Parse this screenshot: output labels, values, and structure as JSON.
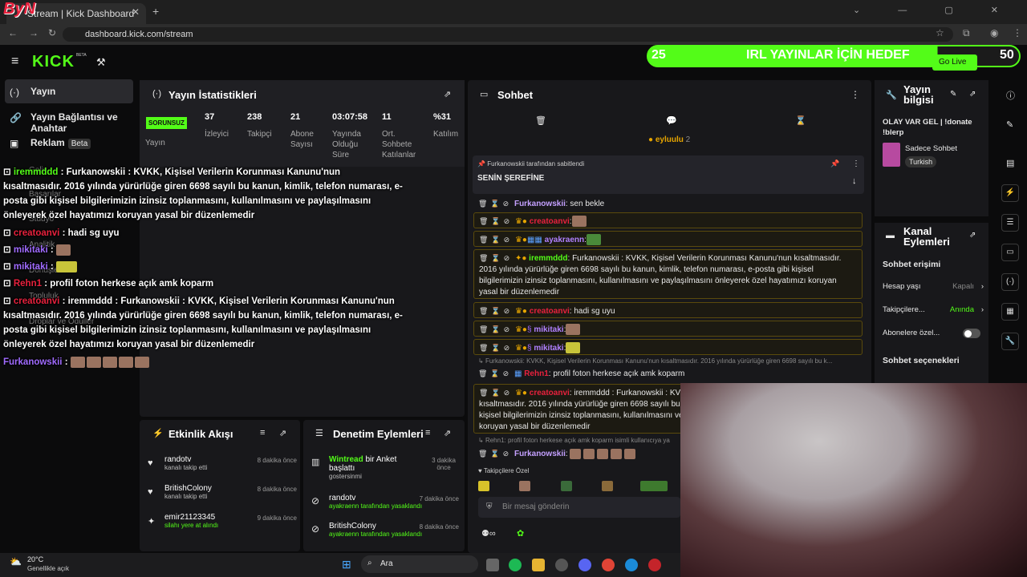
{
  "browser": {
    "tab_title": "Stream | Kick Dashboard",
    "url": "dashboard.kick.com/stream",
    "corner_logo": "ByN"
  },
  "topbar": {
    "logo": "KICK",
    "beta": "BETA",
    "goal_left": "25",
    "goal_text": "IRL YAYINLAR İÇİN HEDEF",
    "goal_right": "50",
    "goal_progress": 0.78,
    "go_live": "Go Live"
  },
  "sidebar": {
    "items": [
      {
        "label": "Yayın",
        "icon": "(·)"
      },
      {
        "label": "Yayın Bağlantısı ve Anahtar",
        "icon": "🔗"
      },
      {
        "label": "Reklam",
        "icon": "▣",
        "badge": "Beta"
      }
    ],
    "hidden_items": [
      "Gelir",
      "Başarılar",
      "Stüdyo",
      "Analitik",
      "Dönüşlere",
      "Topluluk",
      "Droplar ve Ödüller"
    ]
  },
  "stats": {
    "title": "Yayın İstatistikleri",
    "status_badge": "SORUNSUZ",
    "columns": [
      {
        "value": "",
        "label": "Yayın"
      },
      {
        "value": "37",
        "label": "İzleyici"
      },
      {
        "value": "238",
        "label": "Takipçi"
      },
      {
        "value": "21",
        "label": "Abone Sayısı"
      },
      {
        "value": "03:07:58",
        "label": "Yayında Olduğu Süre"
      },
      {
        "value": "11",
        "label": "Ort. Sohbete Katılanlar"
      },
      {
        "value": "%31",
        "label": "Katılım"
      }
    ]
  },
  "overlay": {
    "lines": [
      {
        "name": "iremmddd",
        "cls": "g",
        "text": " : Furkanowskii : KVKK, Kişisel Verilerin Korunması Kanunu'nun"
      },
      {
        "name": "",
        "cls": "",
        "text": "kısaltmasıdır. 2016 yılında yürürlüğe giren 6698 sayılı bu kanun, kimlik, telefon numarası, e-"
      },
      {
        "name": "",
        "cls": "",
        "text": "posta gibi kişisel bilgilerimizin izinsiz toplanmasını, kullanılmasını ve paylaşılmasını"
      },
      {
        "name": "",
        "cls": "",
        "text": "önleyerek özel hayatımızı koruyan yasal bir düzenlemedir"
      },
      {
        "name": "creatoanvi",
        "cls": "r",
        "text": " : hadi sg uyu"
      },
      {
        "name": "mikitaki",
        "cls": "p",
        "text": " :"
      },
      {
        "name": "mikitaki",
        "cls": "p",
        "text": " :"
      },
      {
        "name": "Rehn1",
        "cls": "r",
        "text": " : profil foton herkese açık amk koparm"
      },
      {
        "name": "creatoanvi",
        "cls": "r",
        "text": " : iremmddd : Furkanowskii : KVKK, Kişisel Verilerin Korunması Kanunu'nun"
      },
      {
        "name": "",
        "cls": "",
        "text": "kısaltmasıdır. 2016 yılında yürürlüğe giren 6698 sayılı bu kanun, kimlik, telefon numarası, e-"
      },
      {
        "name": "",
        "cls": "",
        "text": "posta gibi kişisel bilgilerimizin izinsiz toplanmasını, kullanılmasını ve paylaşılmasını"
      },
      {
        "name": "",
        "cls": "",
        "text": "önleyerek özel hayatımızı koruyan yasal bir düzenlemedir"
      },
      {
        "name": "Furkanowskii",
        "cls": "v",
        "text": " :"
      }
    ]
  },
  "activity": {
    "title": "Etkinlik Akışı",
    "items": [
      {
        "name": "randotv",
        "sub": "kanalı takip etti",
        "time": "8 dakika önce"
      },
      {
        "name": "BritishColony",
        "sub": "kanalı takip etti",
        "time": "8 dakika önce"
      },
      {
        "name": "emir21123345",
        "sub": "silahı yere at alındı",
        "time": "9 dakika önce"
      }
    ]
  },
  "moderation": {
    "title": "Denetim Eylemleri",
    "items": [
      {
        "name": "Wintread",
        "action": " bir Anket başlattı",
        "sub": "gostersinmi",
        "time": "3 dakika önce"
      },
      {
        "name": "randotv",
        "action": "",
        "sub": "ayakraenn tarafından yasaklandı",
        "time": "7 dakika önce"
      },
      {
        "name": "BritishColony",
        "action": "",
        "sub": "ayakraenn tarafından yasaklandı",
        "time": "8 dakika önce"
      }
    ]
  },
  "chat": {
    "title": "Sohbet",
    "pinned_user": "eyluulu",
    "pinned_count": "2",
    "pinned_by": "Furkanowskii tarafından sabitlendi",
    "pinned_msg": "SENİN ŞEREFİNE",
    "messages": [
      {
        "name": "Furkanowskii",
        "cls": "v",
        "text": ": sen bekle"
      },
      {
        "name": "creatoanvi",
        "cls": "r",
        "text": ":"
      },
      {
        "name": "ayakraenn",
        "cls": "p",
        "text": ":"
      },
      {
        "name": "iremmddd",
        "cls": "g",
        "text": ": Furkanowskii : KVKK, Kişisel Verilerin Korunması Kanunu'nun kısaltmasıdır. 2016 yılında yürürlüğe giren 6698 sayılı bu kanun, kimlik, telefon numarası, e-posta gibi kişisel bilgilerimizin izinsiz toplanmasını, kullanılmasını ve paylaşılmasını önleyerek özel hayatımızı koruyan yasal bir düzenlemedir"
      },
      {
        "name": "creatoanvi",
        "cls": "r",
        "text": ": hadi sg uyu"
      },
      {
        "name": "mikitaki",
        "cls": "p",
        "text": ":"
      },
      {
        "name": "mikitaki",
        "cls": "p",
        "text": ":"
      },
      {
        "name": "Rehn1",
        "cls": "r",
        "text": ": profil foton herkese açık amk koparm"
      },
      {
        "name": "creatoanvi",
        "cls": "r",
        "text": ": iremmddd : Furkanowskii : KVKK, Kişisel Verilerin Korunması Kanunu'nun kısaltmasıdır. 2016 yılında yürürlüğe giren 6698 sayılı bu kanun, kimlik, telefon numarası, e-posta gibi kişisel bilgilerimizin izinsiz toplanmasını, kullanılmasını ve paylaşılmasını önleyerek özel hayatımızı koruyan yasal bir düzenlemedir"
      },
      {
        "name": "Furkanowskii",
        "cls": "v",
        "text": ":"
      }
    ],
    "reply_rehn": "Furkanowskii: KVKK, Kişisel Verilerin Korunması Kanunu'nun kısaltmasıdır. 2016 yılında yürürlüğe giren 6698 sayılı bu k...",
    "reply_furk": "Rehn1: profil foton herkese açık amk koparm isimli kullanıcıya ya",
    "followers_only": "Takipçilere Özel",
    "input_placeholder": "Bir mesaj gönderin"
  },
  "stream_info": {
    "title": "Yayın bilgisi",
    "stream_title": "OLAY VAR GEL | !donate !blerp",
    "category": "Sadece Sohbet",
    "language": "Turkish"
  },
  "channel_actions": {
    "title": "Kanal Eylemleri",
    "chat_access": "Sohbet erişimi",
    "account_age": "Hesap yaşı",
    "account_age_val": "Kapalı",
    "followers": "Takipçilere...",
    "followers_val": "Anında",
    "subs": "Abonelere özel...",
    "chat_options": "Sohbet seçenekleri"
  },
  "taskbar": {
    "weather_temp": "20°C",
    "weather_desc": "Genellikle açık",
    "search": "Ara"
  }
}
